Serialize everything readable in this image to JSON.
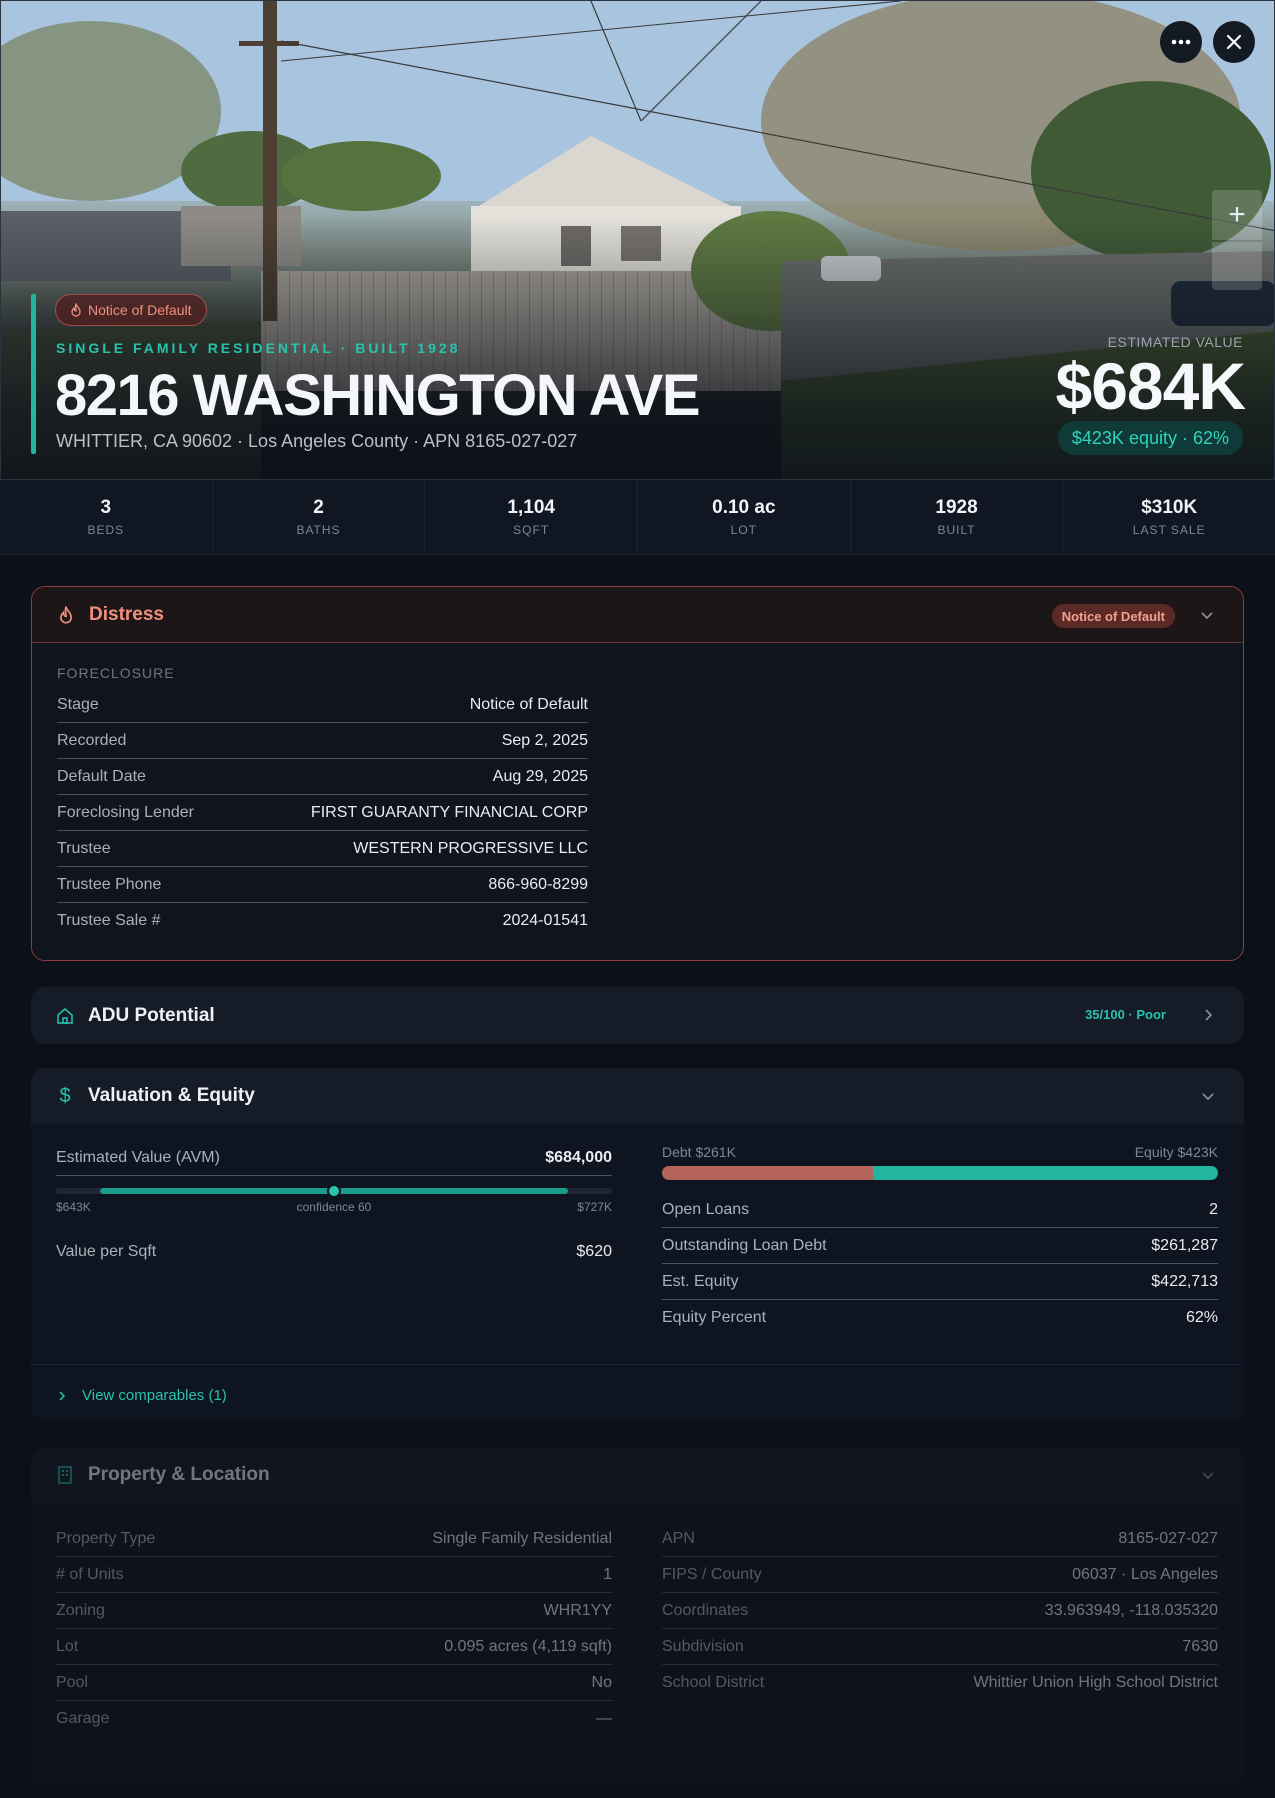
{
  "hero": {
    "badge": "Notice of Default",
    "eyebrow": "SINGLE FAMILY RESIDENTIAL · BUILT 1928",
    "address": "8216 WASHINGTON AVE",
    "subaddress": "WHITTIER, CA 90602 · Los Angeles County · APN 8165-027-027",
    "estimated_label": "ESTIMATED VALUE",
    "estimated_value": "$684K",
    "equity_pill": "$423K equity · 62%",
    "more_icon": "more-horizontal-icon",
    "close_icon": "close-icon",
    "zoom_in": "+"
  },
  "stats": [
    {
      "value": "3",
      "label": "BEDS"
    },
    {
      "value": "2",
      "label": "BATHS"
    },
    {
      "value": "1,104",
      "label": "SQFT"
    },
    {
      "value": "0.10 ac",
      "label": "LOT"
    },
    {
      "value": "1928",
      "label": "BUILT"
    },
    {
      "value": "$310K",
      "label": "LAST SALE"
    }
  ],
  "distress": {
    "title": "Distress",
    "badge": "Notice of Default",
    "section": "FORECLOSURE",
    "rows": [
      {
        "k": "Stage",
        "v": "Notice of Default"
      },
      {
        "k": "Recorded",
        "v": "Sep 2, 2025"
      },
      {
        "k": "Default Date",
        "v": "Aug 29, 2025"
      },
      {
        "k": "Foreclosing Lender",
        "v": "FIRST GUARANTY FINANCIAL CORP"
      },
      {
        "k": "Trustee",
        "v": "WESTERN PROGRESSIVE LLC"
      },
      {
        "k": "Trustee Phone",
        "v": "866-960-8299"
      },
      {
        "k": "Trustee Sale #",
        "v": "2024-01541"
      }
    ]
  },
  "adu": {
    "title": "ADU Potential",
    "score": "35/100 · Poor"
  },
  "valuation": {
    "title": "Valuation & Equity",
    "avm_label": "Estimated Value (AVM)",
    "avm_value": "$684,000",
    "range_low": "$643K",
    "confidence": "confidence 60",
    "range_high": "$727K",
    "range_position": 0.5,
    "ppsf_label": "Value per Sqft",
    "ppsf_value": "$620",
    "debt_label": "Debt $261K",
    "equity_label": "Equity $423K",
    "debt_fraction": 0.38,
    "rows": [
      {
        "k": "Open Loans",
        "v": "2"
      },
      {
        "k": "Outstanding Loan Debt",
        "v": "$261,287"
      },
      {
        "k": "Est. Equity",
        "v": "$422,713"
      },
      {
        "k": "Equity Percent",
        "v": "62%"
      }
    ],
    "comparables_link": "View comparables (1)"
  },
  "property": {
    "title": "Property & Location",
    "left": [
      {
        "k": "Property Type",
        "v": "Single Family Residential"
      },
      {
        "k": "# of Units",
        "v": "1"
      },
      {
        "k": "Zoning",
        "v": "WHR1YY"
      },
      {
        "k": "Lot",
        "v": "0.095 acres (4,119 sqft)"
      },
      {
        "k": "Pool",
        "v": "No"
      },
      {
        "k": "Garage",
        "v": "—"
      }
    ],
    "right": [
      {
        "k": "APN",
        "v": "8165-027-027"
      },
      {
        "k": "FIPS / County",
        "v": "06037 · Los Angeles"
      },
      {
        "k": "Coordinates",
        "v": "33.963949, -118.035320"
      },
      {
        "k": "Subdivision",
        "v": "7630"
      },
      {
        "k": "School District",
        "v": "Whittier Union High School District"
      }
    ]
  },
  "colors": {
    "accent": "#27c3ad",
    "danger": "#f0907c",
    "debt": "#b5645c",
    "equity": "#22b5a0"
  }
}
